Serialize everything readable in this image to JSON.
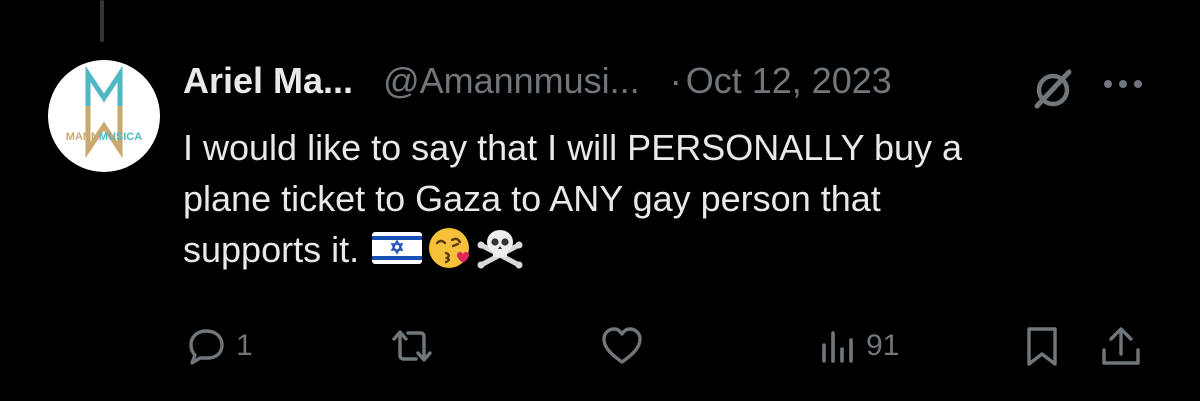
{
  "tweet": {
    "display_name": "Ariel Ma...",
    "handle": "@Amannmusi...",
    "separator": "·",
    "date": "Oct 12, 2023",
    "text_lines": [
      "I would like to say that I will PERSONALLY buy a",
      "plane ticket to Gaza to ANY gay person that",
      "supports it."
    ],
    "emojis": [
      "israel-flag-icon",
      "kissing-heart-face-icon",
      "skull-crossbones-icon"
    ]
  },
  "avatar": {
    "logo_text": "MANNMUSICA",
    "logo_colors": [
      "#4fb8c4",
      "#c9a96e"
    ]
  },
  "actions": {
    "replies": "1",
    "retweets": "",
    "likes": "",
    "views": "91"
  },
  "colors": {
    "background": "#000000",
    "text": "#e7e9ea",
    "muted": "#71767b",
    "thread_line": "#333639"
  }
}
